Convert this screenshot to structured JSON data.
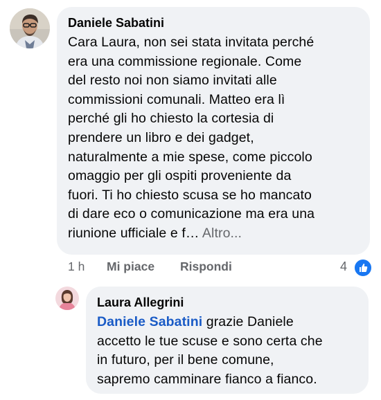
{
  "comment": {
    "author": "Daniele Sabatini",
    "text_lines": [
      "Cara Laura, non sei stata invitata perché",
      "era una commissione regionale. Come",
      "del resto noi non siamo invitati alle",
      "commissioni comunali. Matteo era lì",
      "perché gli ho chiesto la cortesia di",
      "prendere un libro e dei gadget,",
      "naturalmente a mie spese, come piccolo",
      "omaggio per gli ospiti proveniente da",
      "fuori. Ti ho chiesto scusa se ho mancato",
      "di dare eco o comunicazione ma era una",
      "riunione ufficiale e f…"
    ],
    "see_more": "Altro...",
    "time": "1 h",
    "like_label": "Mi piace",
    "reply_label": "Rispondi",
    "reaction_count": "4"
  },
  "reply": {
    "author": "Laura Allegrini",
    "mention": "Daniele Sabatini",
    "first_line_rest": " grazie Daniele",
    "text_lines": [
      "accetto le tue scuse e sono certa che",
      "in futuro, per il bene comune,",
      "sapremo camminare fianco a fianco."
    ]
  },
  "colors": {
    "bubble": "#f0f2f5",
    "secondary_text": "#65676b",
    "mention": "#1a5bc6",
    "like_blue": "#1877f2"
  },
  "icons": {
    "reaction": "like-thumbs-up-icon"
  }
}
